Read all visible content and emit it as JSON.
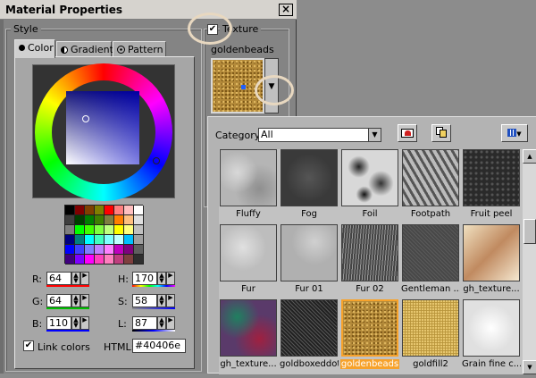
{
  "window": {
    "title": "Material Properties",
    "close_glyph": "×"
  },
  "style_group": {
    "label": "Style"
  },
  "tabs": [
    {
      "label": "Color",
      "icon": "dot-icon"
    },
    {
      "label": "Gradient",
      "icon": "half-circle-icon"
    },
    {
      "label": "Pattern",
      "icon": "globe-icon"
    }
  ],
  "color": {
    "current": "#40406e",
    "fields": {
      "r": {
        "label": "R:",
        "value": "64"
      },
      "g": {
        "label": "G:",
        "value": "64"
      },
      "b": {
        "label": "B:",
        "value": "110"
      },
      "h": {
        "label": "H:",
        "value": "170"
      },
      "s": {
        "label": "S:",
        "value": "58"
      },
      "l": {
        "label": "L:",
        "value": "87"
      }
    },
    "link_colors": {
      "label": "Link colors",
      "checked": true
    },
    "html": {
      "label": "HTML:",
      "value": "#40406e"
    },
    "palette": [
      "#000000",
      "#7f0000",
      "#7f3f00",
      "#7f7f00",
      "#ff0000",
      "#ff7f7f",
      "#ffbfbf",
      "#ffffff",
      "#3f3f3f",
      "#003f00",
      "#007f00",
      "#3f7f00",
      "#7f7f3f",
      "#ff7f00",
      "#ffbf7f",
      "#dfdfdf",
      "#7f7f7f",
      "#00ff00",
      "#3fff00",
      "#7fff3f",
      "#bfff7f",
      "#ffff00",
      "#ffff7f",
      "#bfbfbf",
      "#00007f",
      "#007f7f",
      "#00ffff",
      "#3fffbf",
      "#7fffff",
      "#bfffff",
      "#00bfff",
      "#9f9f9f",
      "#0000ff",
      "#3f3fff",
      "#7f7fff",
      "#bf7fff",
      "#ff7fff",
      "#bf00bf",
      "#7f007f",
      "#5f5f5f",
      "#3f007f",
      "#7f00ff",
      "#ff00ff",
      "#ff3fbf",
      "#ff7fbf",
      "#bf3f7f",
      "#7f3f3f",
      "#2f2f2f"
    ]
  },
  "texture": {
    "label": "Texture",
    "checked": true,
    "name": "goldenbeads"
  },
  "browser": {
    "category_label": "Category:",
    "category_value": "All",
    "items": [
      {
        "name": "Fluffy",
        "color": "#b5b5b5"
      },
      {
        "name": "Fog",
        "color": "#3a3a3a"
      },
      {
        "name": "Foil",
        "color": "#d8d8d8"
      },
      {
        "name": "Footpath",
        "color": "#8a8a8a"
      },
      {
        "name": "Fruit peel",
        "color": "#2a2a2a"
      },
      {
        "name": "Fur",
        "color": "#bdbdbd"
      },
      {
        "name": "Fur 01",
        "color": "#b0b0b0"
      },
      {
        "name": "Fur 02",
        "color": "#6a6a6a"
      },
      {
        "name": "Gentleman ...",
        "color": "#505050"
      },
      {
        "name": "gh_texture...",
        "color": "#caa080"
      },
      {
        "name": "gh_texture...",
        "color": "#5a3a6a"
      },
      {
        "name": "goldboxeddot",
        "color": "#3a3a3a"
      },
      {
        "name": "goldenbeads",
        "color": "#b48a3a"
      },
      {
        "name": "goldfill2",
        "color": "#b8943a"
      },
      {
        "name": "Grain fine c...",
        "color": "#e0e0e0"
      }
    ]
  }
}
